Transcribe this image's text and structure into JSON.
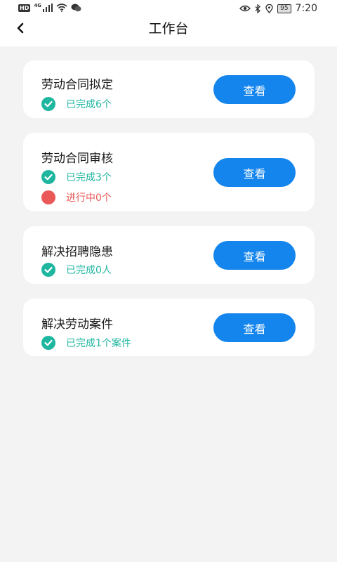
{
  "status_bar": {
    "hd": "HD",
    "network": "4G",
    "battery": "95",
    "time": "7:20"
  },
  "header": {
    "title": "工作台"
  },
  "cards": [
    {
      "title": "劳动合同拟定",
      "button": "查看",
      "stats": [
        {
          "type": "done",
          "text": "已完成6个",
          "color": "#1fb6a0",
          "icon": "check-circle-icon"
        }
      ]
    },
    {
      "title": "劳动合同审核",
      "button": "查看",
      "stats": [
        {
          "type": "done",
          "text": "已完成3个",
          "color": "#1fb6a0",
          "icon": "check-circle-icon"
        },
        {
          "type": "progress",
          "text": "进行中0个",
          "color": "#ea5858",
          "icon": "red-dot-icon"
        }
      ]
    },
    {
      "title": "解决招聘隐患",
      "button": "查看",
      "stats": [
        {
          "type": "done",
          "text": "已完成0人",
          "color": "#1fb6a0",
          "icon": "check-circle-icon"
        }
      ]
    },
    {
      "title": "解决劳动案件",
      "button": "查看",
      "stats": [
        {
          "type": "done",
          "text": "已完成1个案件",
          "color": "#1fb6a0",
          "icon": "check-circle-icon"
        }
      ]
    }
  ],
  "colors": {
    "accent": "#1485ec",
    "done": "#1fb6a0",
    "in_progress": "#ea5858",
    "background": "#f3f3f3"
  }
}
